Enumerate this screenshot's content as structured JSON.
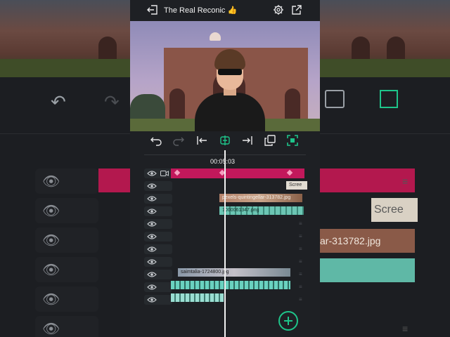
{
  "app": {
    "title": "The Real Reconic 👍",
    "accent_color": "#1ec48a",
    "track_color": "#c2185b"
  },
  "header": {
    "exit_icon": "exit-icon",
    "settings_icon": "gear-icon",
    "share_icon": "share-icon"
  },
  "toolbar": {
    "items": [
      "undo-icon",
      "redo-icon",
      "jump-start-icon",
      "split-icon",
      "jump-end-icon",
      "copy-icon",
      "fit-icon"
    ]
  },
  "timeline": {
    "timecode": "00:05:03",
    "clips": {
      "scree": "Scree",
      "pexels": "pexels-quintingellar-313782.jpg",
      "number": "1000061347.png",
      "saimtalia": "saimtalia-1724800.jpg"
    }
  },
  "background": {
    "clip_scree": "Scree",
    "clip_pexels": "ar-313782.jpg"
  }
}
